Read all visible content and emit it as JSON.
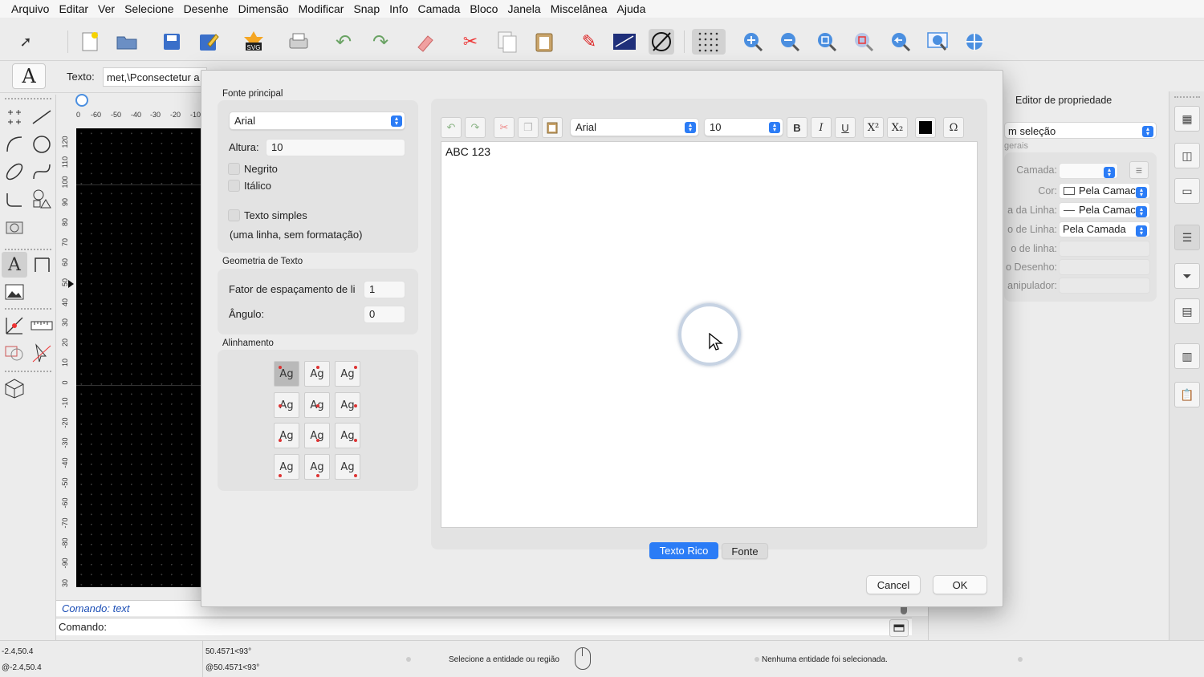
{
  "menubar": [
    "Arquivo",
    "Editar",
    "Ver",
    "Selecione",
    "Desenhe",
    "Dimensão",
    "Modificar",
    "Snap",
    "Info",
    "Camada",
    "Bloco",
    "Janela",
    "Miscelânea",
    "Ajuda"
  ],
  "toolbar": {
    "svg_label": "SVG"
  },
  "optbar": {
    "text_label": "Texto:",
    "text_value": "met,\\Pconsectetur a",
    "tool_glyph": "A"
  },
  "ruler": {
    "h_ticks": [
      "0",
      "-60",
      "-50",
      "-40",
      "-30",
      "-20",
      "-10"
    ],
    "v_ticks": [
      "120",
      "110",
      "100",
      "90",
      "80",
      "70",
      "60",
      "50",
      "40",
      "30",
      "20",
      "10",
      "0",
      "-10",
      "-20",
      "-30",
      "-40",
      "-50",
      "-60",
      "-70",
      "-80",
      "-90",
      "30"
    ]
  },
  "command": {
    "history": "Comando: text",
    "prompt": "Comando:"
  },
  "status": {
    "abs_coord": "-2.4,50.4",
    "rel_coord": "@-2.4,50.4",
    "polar_coord": "50.4571<93°",
    "rel_polar": "@50.4571<93°",
    "hint": "Selecione a entidade ou região",
    "selection": "Nenhuma entidade foi selecionada."
  },
  "property_editor": {
    "title": "Editor de propriedade",
    "selection": "m seleção",
    "section": "gerais",
    "rows": [
      {
        "label": "Camada:",
        "value": ""
      },
      {
        "label": "Cor:",
        "value": "Pela Camac"
      },
      {
        "label": "a da Linha:",
        "value": "Pela Camac"
      },
      {
        "label": "o de Linha:",
        "value": "Pela Camada"
      },
      {
        "label": "o de linha:",
        "value": ""
      },
      {
        "label": "o Desenho:",
        "value": ""
      },
      {
        "label": "anipulador:",
        "value": ""
      }
    ]
  },
  "dialog": {
    "font_group_title": "Fonte principal",
    "font_value": "Arial",
    "height_label": "Altura:",
    "height_value": "10",
    "bold_label": "Negrito",
    "italic_label": "Itálico",
    "plain_label": "Texto simples",
    "plain_note": "(uma linha, sem formatação)",
    "geometry_title": "Geometria de Texto",
    "spacing_label": "Fator de espaçamento de li",
    "spacing_value": "1",
    "angle_label": "Ângulo:",
    "angle_value": "0",
    "align_title": "Alinhamento",
    "align_glyph": "Ag",
    "editor_font": "Arial",
    "editor_size": "10",
    "bold_btn": "B",
    "italic_btn": "I",
    "underline_btn": "U",
    "sup_btn": "X²",
    "sub_btn": "X₂",
    "symbol_btn": "Ω",
    "editor_text": "ABC 123",
    "tab_rich": "Texto Rico",
    "tab_font": "Fonte",
    "cancel": "Cancel",
    "ok": "OK"
  },
  "colors": {
    "accent": "#2b7cf6",
    "canvas": "#000000"
  }
}
